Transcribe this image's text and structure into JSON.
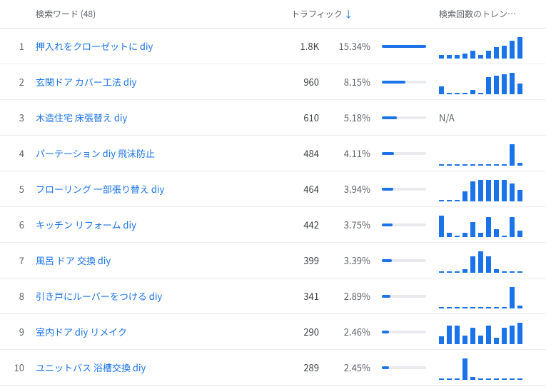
{
  "columns": {
    "keyword_header": "検索ワード (48)",
    "traffic_header": "トラフィック",
    "trend_header": "検索回数のトレン…"
  },
  "max_pct": 15.34,
  "rows": [
    {
      "rank": "1",
      "keyword": "押入れをクローゼットに diy",
      "traffic": "1.8K",
      "pct": "15.34%",
      "pct_num": 15.34,
      "trend": [
        3,
        3,
        3,
        4,
        6,
        3,
        6,
        9,
        10,
        14,
        17
      ],
      "na": false
    },
    {
      "rank": "2",
      "keyword": "玄関ドア カバー工法 diy",
      "traffic": "960",
      "pct": "8.15%",
      "pct_num": 8.15,
      "trend": [
        6,
        1,
        1,
        1,
        3,
        1,
        13,
        14,
        15,
        16,
        8
      ],
      "na": false
    },
    {
      "rank": "3",
      "keyword": "木造住宅 床張替え diy",
      "traffic": "610",
      "pct": "5.18%",
      "pct_num": 5.18,
      "trend": [],
      "na": true
    },
    {
      "rank": "4",
      "keyword": "パーテーション diy 飛沫防止",
      "traffic": "484",
      "pct": "4.11%",
      "pct_num": 4.11,
      "trend": [
        0,
        0,
        0,
        0,
        0,
        0,
        0,
        0,
        0,
        15,
        2
      ],
      "na": false
    },
    {
      "rank": "5",
      "keyword": "フローリング 一部張り替え diy",
      "traffic": "464",
      "pct": "3.94%",
      "pct_num": 3.94,
      "trend": [
        0,
        0,
        0,
        8,
        16,
        17,
        17,
        17,
        17,
        14,
        9
      ],
      "na": false
    },
    {
      "rank": "6",
      "keyword": "キッチン リフォーム diy",
      "traffic": "442",
      "pct": "3.75%",
      "pct_num": 3.75,
      "trend": [
        14,
        3,
        0,
        3,
        10,
        3,
        13,
        5,
        0,
        13,
        4
      ],
      "na": false
    },
    {
      "rank": "7",
      "keyword": "風呂 ドア 交換 diy",
      "traffic": "399",
      "pct": "3.39%",
      "pct_num": 3.39,
      "trend": [
        0,
        0,
        0,
        3,
        13,
        17,
        13,
        3,
        0,
        0,
        0
      ],
      "na": false
    },
    {
      "rank": "8",
      "keyword": "引き戸にルーバーをつける diy",
      "traffic": "341",
      "pct": "2.89%",
      "pct_num": 2.89,
      "trend": [
        0,
        0,
        0,
        0,
        0,
        0,
        0,
        0,
        0,
        17,
        2
      ],
      "na": false
    },
    {
      "rank": "9",
      "keyword": "室内ドア diy リメイク",
      "traffic": "290",
      "pct": "2.46%",
      "pct_num": 2.46,
      "trend": [
        6,
        15,
        15,
        7,
        13,
        7,
        15,
        5,
        13,
        15,
        17
      ],
      "na": false
    },
    {
      "rank": "10",
      "keyword": "ユニットバス 浴槽交換 diy",
      "traffic": "289",
      "pct": "2.45%",
      "pct_num": 2.45,
      "trend": [
        0,
        0,
        0,
        14,
        2,
        0,
        0,
        0,
        0,
        0,
        0
      ],
      "na": false
    }
  ],
  "chart_data": {
    "type": "table",
    "title": "検索ワード (48)",
    "columns": [
      "rank",
      "keyword",
      "traffic",
      "percent",
      "trend_sparkline"
    ],
    "series_note": "Each row has a sparkline of ~11 bars; values are relative heights 0-17px as read from pixels. Row 3 trend is N/A.",
    "rows": [
      {
        "rank": 1,
        "keyword": "押入れをクローゼットに diy",
        "traffic": "1.8K",
        "percent": 15.34,
        "spark": [
          3,
          3,
          3,
          4,
          6,
          3,
          6,
          9,
          10,
          14,
          17
        ]
      },
      {
        "rank": 2,
        "keyword": "玄関ドア カバー工法 diy",
        "traffic": 960,
        "percent": 8.15,
        "spark": [
          6,
          1,
          1,
          1,
          3,
          1,
          13,
          14,
          15,
          16,
          8
        ]
      },
      {
        "rank": 3,
        "keyword": "木造住宅 床張替え diy",
        "traffic": 610,
        "percent": 5.18,
        "spark": "N/A"
      },
      {
        "rank": 4,
        "keyword": "パーテーション diy 飛沫防止",
        "traffic": 484,
        "percent": 4.11,
        "spark": [
          0,
          0,
          0,
          0,
          0,
          0,
          0,
          0,
          0,
          15,
          2
        ]
      },
      {
        "rank": 5,
        "keyword": "フローリング 一部張り替え diy",
        "traffic": 464,
        "percent": 3.94,
        "spark": [
          0,
          0,
          0,
          8,
          16,
          17,
          17,
          17,
          17,
          14,
          9
        ]
      },
      {
        "rank": 6,
        "keyword": "キッチン リフォーム diy",
        "traffic": 442,
        "percent": 3.75,
        "spark": [
          14,
          3,
          0,
          3,
          10,
          3,
          13,
          5,
          0,
          13,
          4
        ]
      },
      {
        "rank": 7,
        "keyword": "風呂 ドア 交換 diy",
        "traffic": 399,
        "percent": 3.39,
        "spark": [
          0,
          0,
          0,
          3,
          13,
          17,
          13,
          3,
          0,
          0,
          0
        ]
      },
      {
        "rank": 8,
        "keyword": "引き戸にルーバーをつける diy",
        "traffic": 341,
        "percent": 2.89,
        "spark": [
          0,
          0,
          0,
          0,
          0,
          0,
          0,
          0,
          0,
          17,
          2
        ]
      },
      {
        "rank": 9,
        "keyword": "室内ドア diy リメイク",
        "traffic": 290,
        "percent": 2.46,
        "spark": [
          6,
          15,
          15,
          7,
          13,
          7,
          15,
          5,
          13,
          15,
          17
        ]
      },
      {
        "rank": 10,
        "keyword": "ユニットバス 浴槽交換 diy",
        "traffic": 289,
        "percent": 2.45,
        "spark": [
          0,
          0,
          0,
          14,
          2,
          0,
          0,
          0,
          0,
          0,
          0
        ]
      }
    ]
  }
}
